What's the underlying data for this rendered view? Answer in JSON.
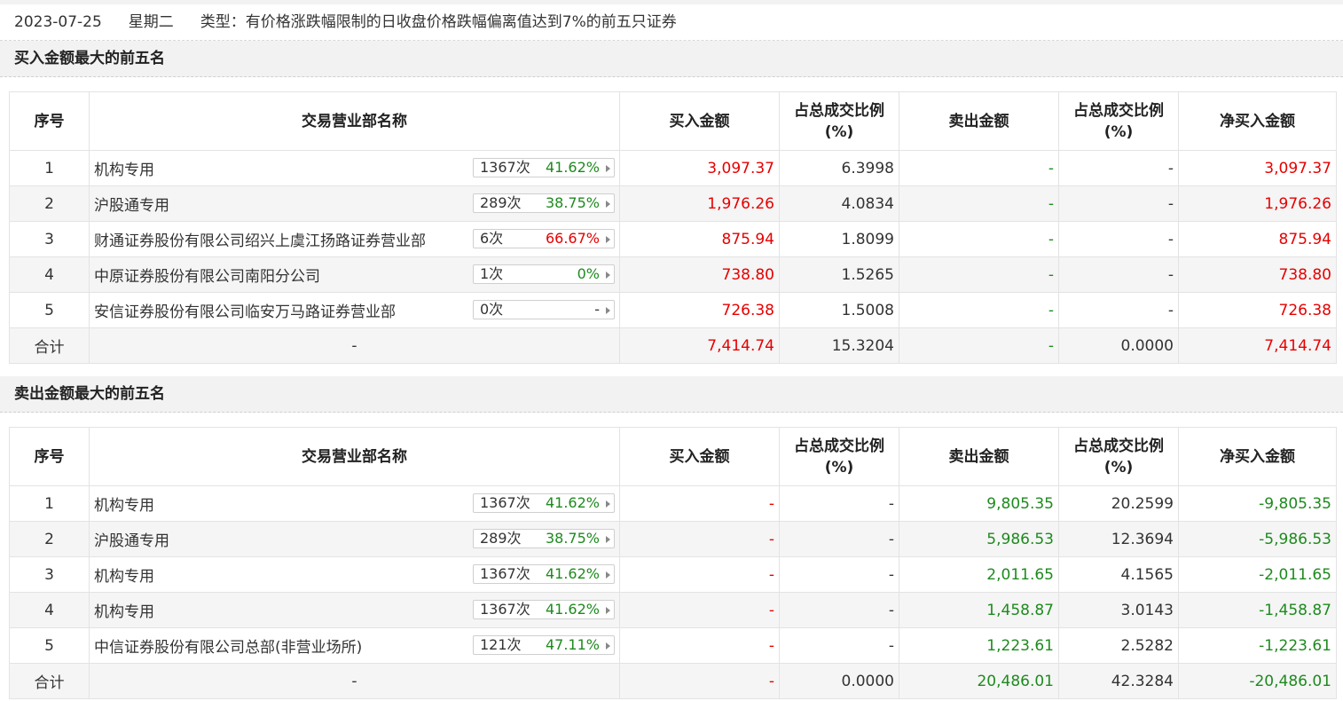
{
  "header": {
    "date": "2023-07-25",
    "weekday": "星期二",
    "type_text": "类型：有价格涨跌幅限制的日收盘价格跌幅偏离值达到7%的前五只证券"
  },
  "columns": {
    "index": "序号",
    "name": "交易营业部名称",
    "buy": "买入金额",
    "buy_ratio": "占总成交比例(%)",
    "sell": "卖出金额",
    "sell_ratio": "占总成交比例(%)",
    "net": "净买入金额"
  },
  "colors": {
    "up": "#e60000",
    "down": "#1e8a1e"
  },
  "icons": {
    "pill_arrow": "chevron-right-icon"
  },
  "buy_section": {
    "title": "买入金额最大的前五名",
    "rows": [
      {
        "index": "1",
        "name": "机构专用",
        "count": "1367次",
        "pct": "41.62%",
        "buy": "3,097.37",
        "buy_ratio": "6.3998",
        "sell": "-",
        "sell_ratio": "-",
        "net": "3,097.37"
      },
      {
        "index": "2",
        "name": "沪股通专用",
        "count": "289次",
        "pct": "38.75%",
        "buy": "1,976.26",
        "buy_ratio": "4.0834",
        "sell": "-",
        "sell_ratio": "-",
        "net": "1,976.26"
      },
      {
        "index": "3",
        "name": "财通证券股份有限公司绍兴上虞江扬路证券营业部",
        "count": "6次",
        "pct": "66.67%",
        "buy": "875.94",
        "buy_ratio": "1.8099",
        "sell": "-",
        "sell_ratio": "-",
        "net": "875.94"
      },
      {
        "index": "4",
        "name": "中原证券股份有限公司南阳分公司",
        "count": "1次",
        "pct": "0%",
        "buy": "738.80",
        "buy_ratio": "1.5265",
        "sell": "-",
        "sell_ratio": "-",
        "net": "738.80"
      },
      {
        "index": "5",
        "name": "安信证券股份有限公司临安万马路证券营业部",
        "count": "0次",
        "pct": "-",
        "buy": "726.38",
        "buy_ratio": "1.5008",
        "sell": "-",
        "sell_ratio": "-",
        "net": "726.38"
      }
    ],
    "total": {
      "label": "合计",
      "name": "-",
      "buy": "7,414.74",
      "buy_ratio": "15.3204",
      "sell": "-",
      "sell_ratio": "0.0000",
      "net": "7,414.74"
    }
  },
  "sell_section": {
    "title": "卖出金额最大的前五名",
    "rows": [
      {
        "index": "1",
        "name": "机构专用",
        "count": "1367次",
        "pct": "41.62%",
        "buy": "-",
        "buy_ratio": "-",
        "sell": "9,805.35",
        "sell_ratio": "20.2599",
        "net": "-9,805.35"
      },
      {
        "index": "2",
        "name": "沪股通专用",
        "count": "289次",
        "pct": "38.75%",
        "buy": "-",
        "buy_ratio": "-",
        "sell": "5,986.53",
        "sell_ratio": "12.3694",
        "net": "-5,986.53"
      },
      {
        "index": "3",
        "name": "机构专用",
        "count": "1367次",
        "pct": "41.62%",
        "buy": "-",
        "buy_ratio": "-",
        "sell": "2,011.65",
        "sell_ratio": "4.1565",
        "net": "-2,011.65"
      },
      {
        "index": "4",
        "name": "机构专用",
        "count": "1367次",
        "pct": "41.62%",
        "buy": "-",
        "buy_ratio": "-",
        "sell": "1,458.87",
        "sell_ratio": "3.0143",
        "net": "-1,458.87"
      },
      {
        "index": "5",
        "name": "中信证券股份有限公司总部(非营业场所)",
        "count": "121次",
        "pct": "47.11%",
        "buy": "-",
        "buy_ratio": "-",
        "sell": "1,223.61",
        "sell_ratio": "2.5282",
        "net": "-1,223.61"
      }
    ],
    "total": {
      "label": "合计",
      "name": "-",
      "buy": "-",
      "buy_ratio": "0.0000",
      "sell": "20,486.01",
      "sell_ratio": "42.3284",
      "net": "-20,486.01"
    }
  }
}
